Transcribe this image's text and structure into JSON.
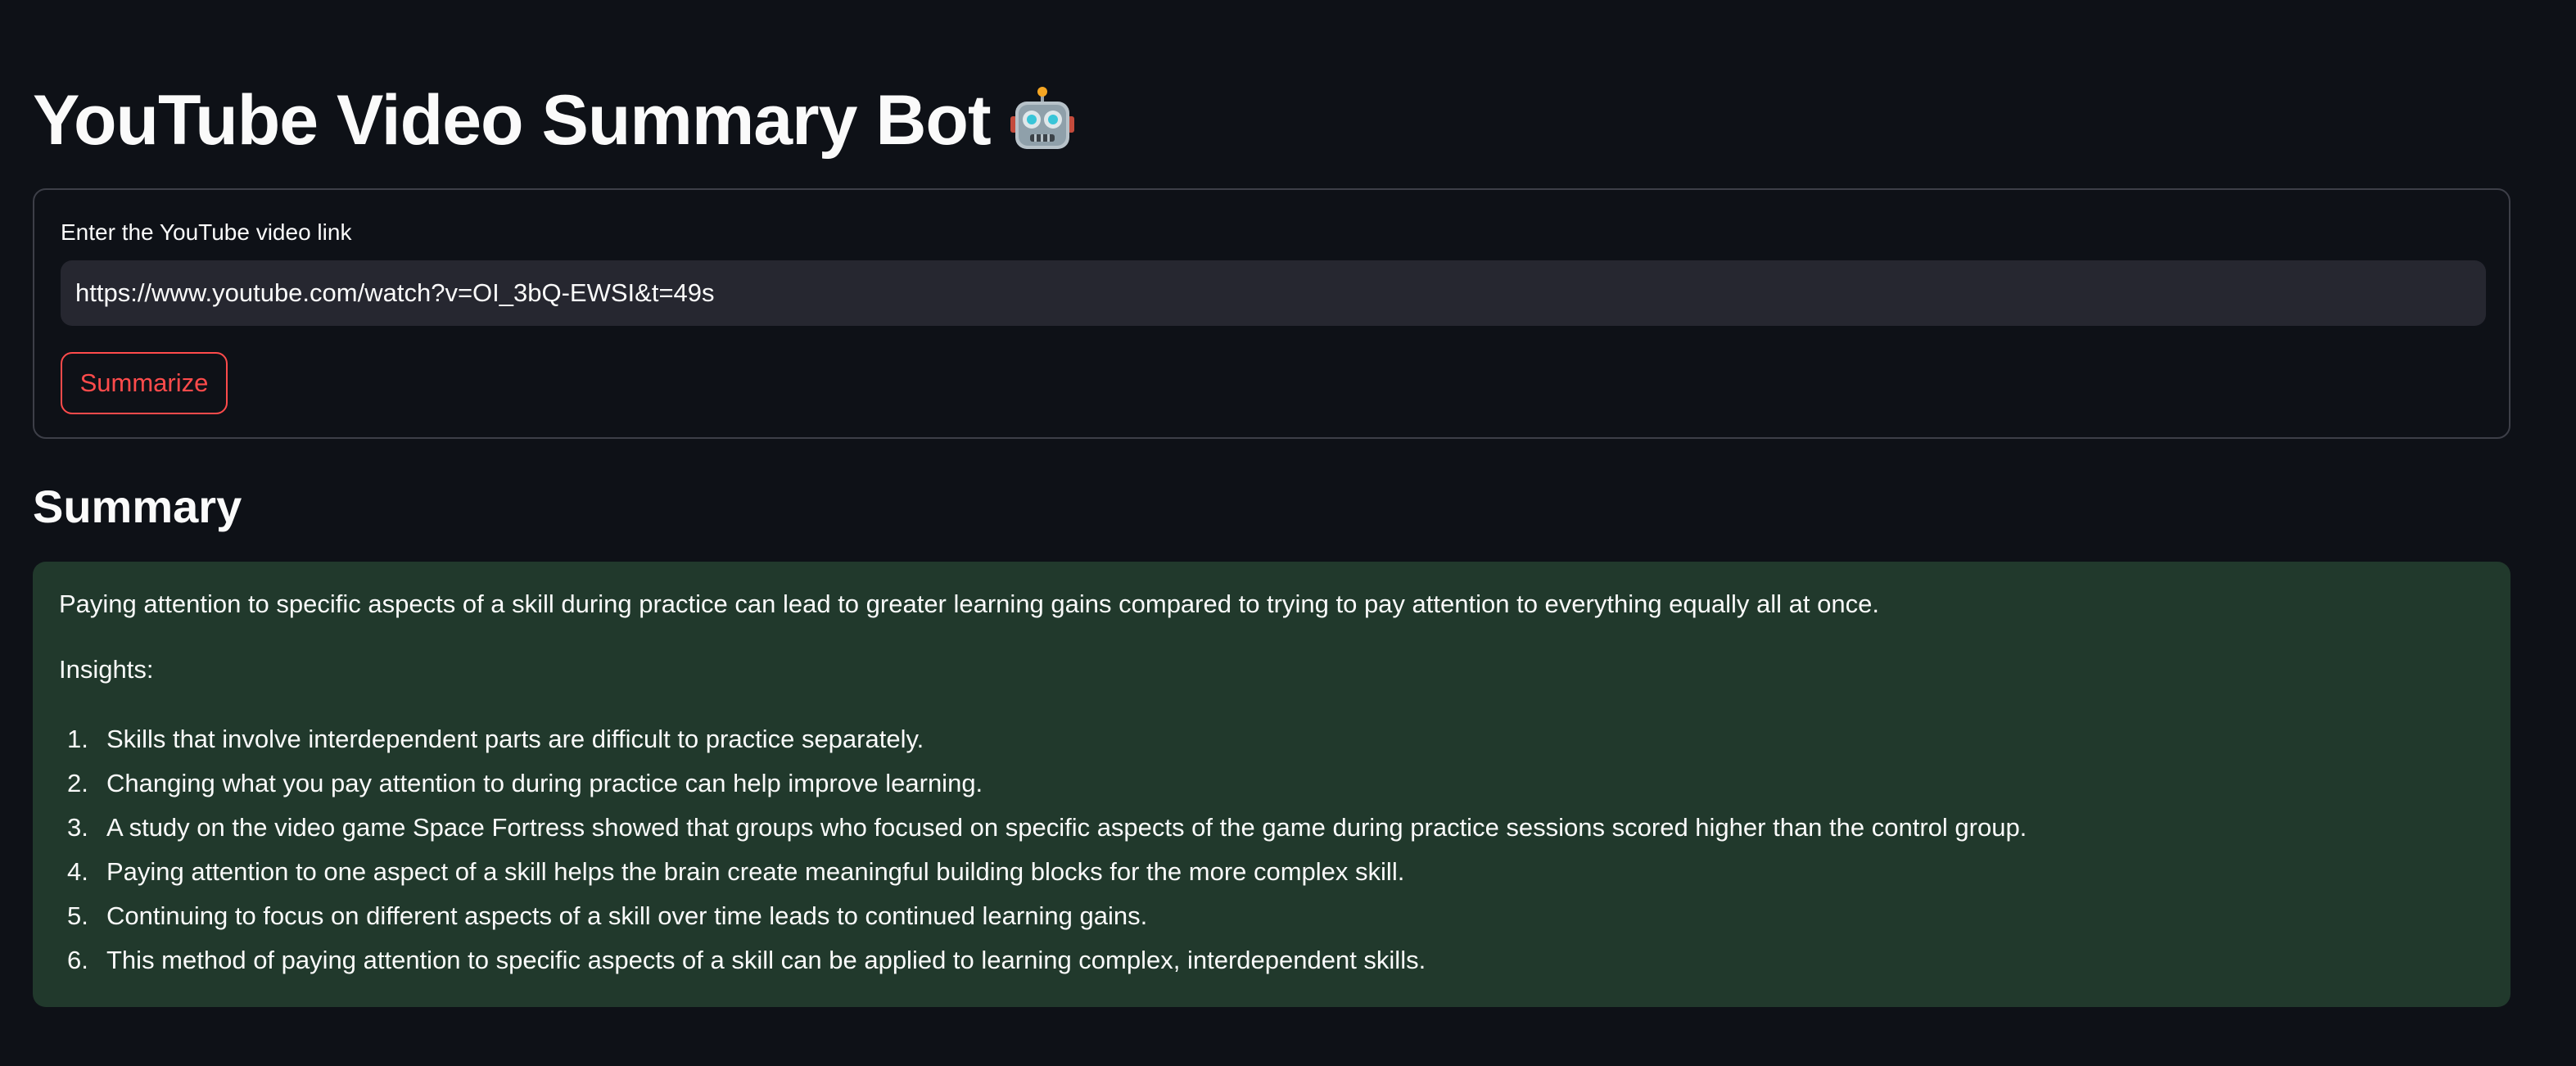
{
  "header": {
    "title": "YouTube Video Summary Bot",
    "title_icon": "robot-emoji"
  },
  "form": {
    "input_label": "Enter the YouTube video link",
    "url_value": "https://www.youtube.com/watch?v=OI_3bQ-EWSI&t=49s",
    "submit_label": "Summarize"
  },
  "summary": {
    "heading": "Summary",
    "intro": "Paying attention to specific aspects of a skill during practice can lead to greater learning gains compared to trying to pay attention to everything equally all at once.",
    "insights_label": "Insights:",
    "insights": [
      {
        "num": "1.",
        "text": "Skills that involve interdependent parts are difficult to practice separately."
      },
      {
        "num": "2.",
        "text": "Changing what you pay attention to during practice can help improve learning."
      },
      {
        "num": "3.",
        "text": "A study on the video game Space Fortress showed that groups who focused on specific aspects of the game during practice sessions scored higher than the control group."
      },
      {
        "num": "4.",
        "text": "Paying attention to one aspect of a skill helps the brain create meaningful building blocks for the more complex skill."
      },
      {
        "num": "5.",
        "text": "Continuing to focus on different aspects of a skill over time leads to continued learning gains."
      },
      {
        "num": "6.",
        "text": "This method of paying attention to specific aspects of a skill can be applied to learning complex, interdependent skills."
      }
    ]
  },
  "colors": {
    "background": "#0e1117",
    "accent": "#ff4b4b",
    "success_box": "#21392c",
    "input_bg": "#262730"
  }
}
